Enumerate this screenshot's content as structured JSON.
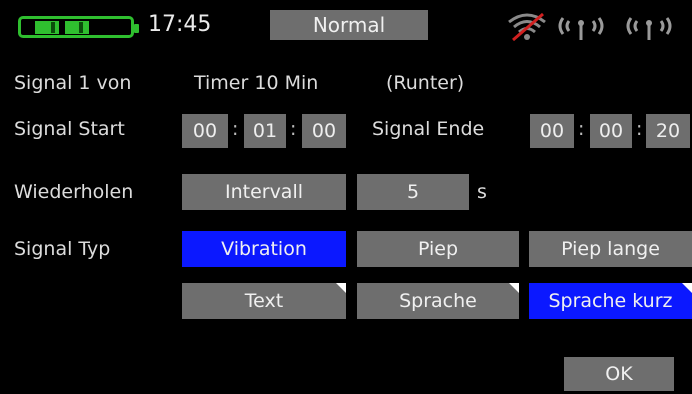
{
  "status": {
    "time": "17:45",
    "mode": "Normal",
    "battery_color": "#2fbf2f"
  },
  "icons": [
    "no-signal-icon",
    "antenna-icon",
    "antenna-icon"
  ],
  "rows": {
    "signal_von": {
      "label": "Signal 1 von",
      "value": "Timer 10 Min",
      "direction": "(Runter)"
    },
    "signal_start": {
      "label": "Signal Start",
      "h": "00",
      "m": "01",
      "s": "00"
    },
    "signal_ende": {
      "label": "Signal Ende",
      "h": "00",
      "m": "00",
      "s": "20"
    },
    "wiederholen": {
      "label": "Wiederholen",
      "mode": "Intervall",
      "count": "5",
      "unit": "s"
    },
    "signal_typ": {
      "label": "Signal Typ",
      "options": [
        "Vibration",
        "Piep",
        "Piep lange",
        "Text",
        "Sprache",
        "Sprache kurz"
      ]
    }
  },
  "ok_label": "OK",
  "colors": {
    "active": "#0b18ff",
    "button": "#6e6e6e"
  }
}
